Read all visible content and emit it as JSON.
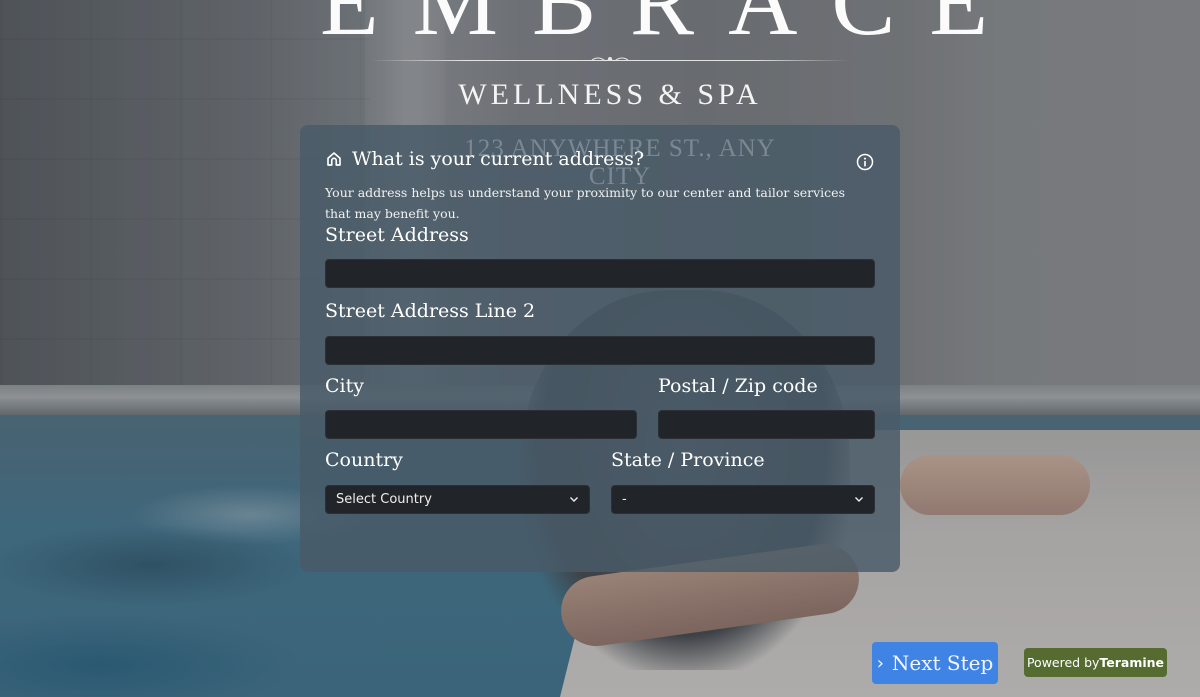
{
  "brand": {
    "name": "EMBRACE",
    "tagline": "WELLNESS & SPA",
    "address_watermark": "123 ANYWHERE ST., ANY CITY"
  },
  "form": {
    "question_title": "What is your current address?",
    "question_icon": "home-icon",
    "info_icon": "info-icon",
    "description": "Your address helps us understand your proximity to our center and tailor services that may benefit you.",
    "fields": {
      "street_address": {
        "label": "Street Address",
        "value": "",
        "placeholder": ""
      },
      "street_address_2": {
        "label": "Street Address Line 2",
        "value": "",
        "placeholder": ""
      },
      "city": {
        "label": "City",
        "value": "",
        "placeholder": ""
      },
      "postal_code": {
        "label": "Postal / Zip code",
        "value": "",
        "placeholder": ""
      },
      "country": {
        "label": "Country",
        "selected": "Select Country"
      },
      "state": {
        "label": "State / Province",
        "selected": "-"
      }
    }
  },
  "actions": {
    "next_step_label": "Next Step",
    "powered_by_prefix": "Powered by",
    "powered_by_brand": "Teramine"
  },
  "colors": {
    "next_button": "#3f84e5",
    "powered_badge": "#556b2f",
    "card_bg": "#485a68",
    "input_bg": "#212428"
  }
}
